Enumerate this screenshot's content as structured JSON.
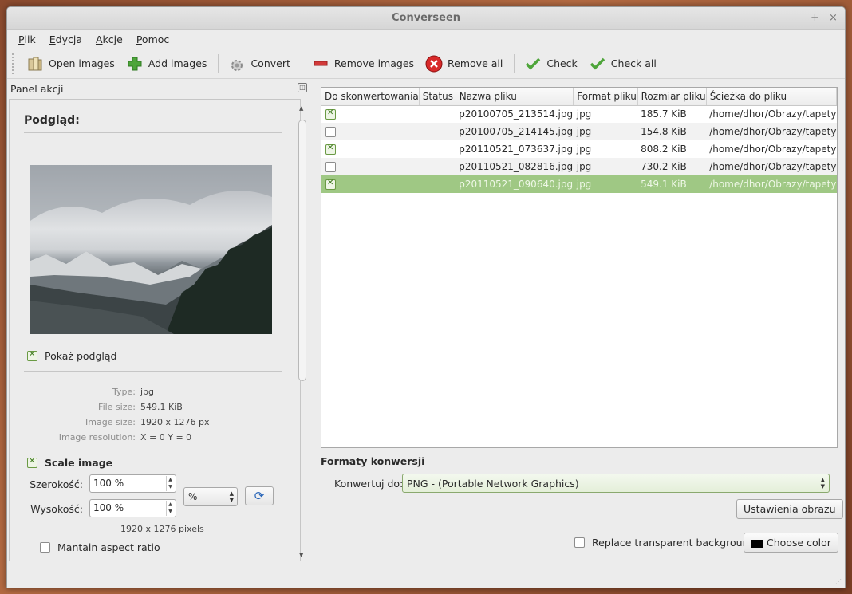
{
  "window": {
    "title": "Converseen"
  },
  "menu": [
    {
      "label": "Plik",
      "underline": "P",
      "rest": "lik"
    },
    {
      "label": "Edycja",
      "underline": "E",
      "rest": "dycja"
    },
    {
      "label": "Akcje",
      "underline": "A",
      "rest": "kcje"
    },
    {
      "label": "Pomoc",
      "underline": "P",
      "rest": "omoc"
    }
  ],
  "toolbar": {
    "open_images": "Open images",
    "add_images": "Add images",
    "convert": "Convert",
    "remove_images": "Remove images",
    "remove_all": "Remove all",
    "check": "Check",
    "check_all": "Check all"
  },
  "panel": {
    "title": "Panel akcji",
    "preview_title": "Podgląd:",
    "show_preview": "Pokaż podgląd",
    "info": {
      "type_label": "Type:",
      "type_value": "jpg",
      "size_label": "File size:",
      "size_value": "549.1 KiB",
      "dims_label": "Image size:",
      "dims_value": "1920 x 1276 px",
      "res_label": "Image resolution:",
      "res_value": "X = 0 Y = 0"
    },
    "scale_image": "Scale image",
    "width_label": "Szerokość:",
    "width_value": "100 %",
    "height_label": "Wysokość:",
    "height_value": "100 %",
    "unit_value": "%",
    "pixels": "1920 x 1276 pixels",
    "aspect_ratio": "Mantain aspect ratio"
  },
  "table": {
    "columns": [
      "Do skonwertowania",
      "Status",
      "Nazwa pliku",
      "Format pliku",
      "Rozmiar pliku",
      "Ścieżka do pliku"
    ],
    "rows": [
      {
        "checked": true,
        "status": "",
        "name": "p20100705_213514.jpg",
        "format": "jpg",
        "size": "185.7 KiB",
        "path": "/home/dhor/Obrazy/tapety"
      },
      {
        "checked": false,
        "status": "",
        "name": "p20100705_214145.jpg",
        "format": "jpg",
        "size": "154.8 KiB",
        "path": "/home/dhor/Obrazy/tapety"
      },
      {
        "checked": true,
        "status": "",
        "name": "p20110521_073637.jpg",
        "format": "jpg",
        "size": "808.2 KiB",
        "path": "/home/dhor/Obrazy/tapety"
      },
      {
        "checked": false,
        "status": "",
        "name": "p20110521_082816.jpg",
        "format": "jpg",
        "size": "730.2 KiB",
        "path": "/home/dhor/Obrazy/tapety"
      },
      {
        "checked": true,
        "status": "",
        "name": "p20110521_090640.jpg",
        "format": "jpg",
        "size": "549.1 KiB",
        "path": "/home/dhor/Obrazy/tapety"
      }
    ]
  },
  "formats": {
    "title": "Formaty konwersji",
    "convert_to_label": "Konwertuj do:",
    "convert_to_value": "PNG - (Portable Network Graphics)",
    "image_settings": "Ustawienia obrazu",
    "replace_bg": "Replace transparent background",
    "choose_color": "Choose color"
  },
  "colors": {
    "selection": "#9fc884",
    "accent": "#6a9a44"
  }
}
